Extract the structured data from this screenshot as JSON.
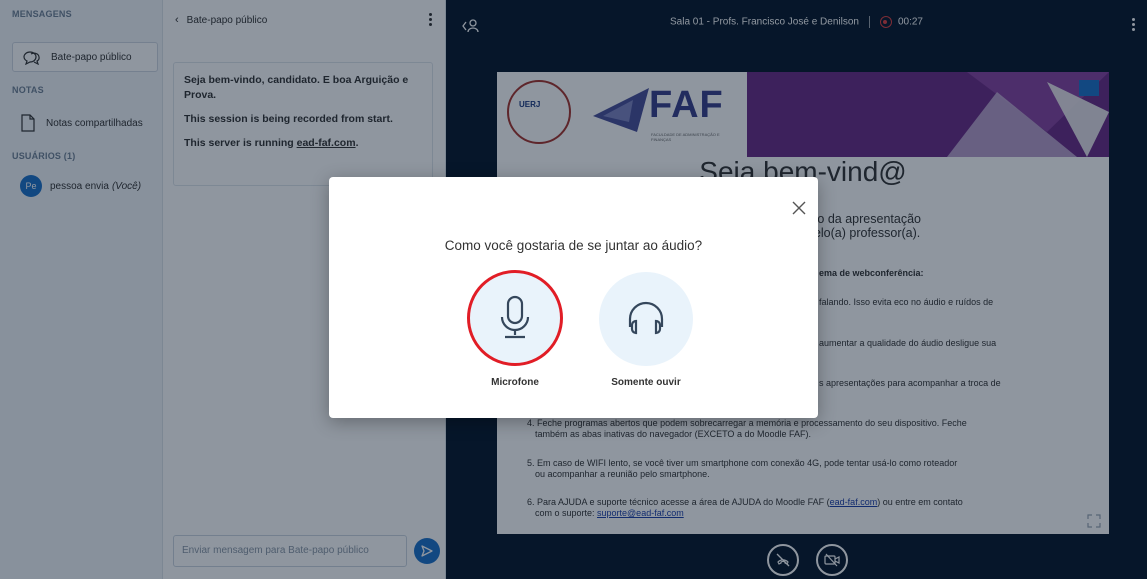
{
  "sidebar": {
    "messages_title": "MENSAGENS",
    "public_chat_label": "Bate-papo público",
    "notes_title": "NOTAS",
    "shared_notes_label": "Notas compartilhadas",
    "users_title": "USUÁRIOS (1)",
    "user": {
      "initials": "Pe",
      "name": "pessoa envia",
      "you_tag": "(Você)"
    }
  },
  "chat": {
    "header_title": "Bate-papo público",
    "welcome_line1": "Seja bem-vindo, candidato. E boa Arguição e Prova.",
    "welcome_line2": "This session is being recorded from start.",
    "welcome_line3_prefix": "This server is running ",
    "welcome_line3_link": "ead-faf.com",
    "welcome_line3_suffix": ".",
    "input_placeholder": "Enviar mensagem para Bate-papo público"
  },
  "topbar": {
    "room_title": "Sala 01 - Profs. Francisco José e Denilson",
    "recording_time": "00:27"
  },
  "slide": {
    "uerj_label": "UERJ",
    "faf_word": "FAF",
    "faf_subtitle": "FACULDADE DE ADMINISTRAÇÃO E FINANÇAS",
    "title": "Seja bem-vind@",
    "subtitle_line1": "nto da apresentação",
    "subtitle_line2": "pelo(a) professor(a).",
    "rules_heading": "ema de webconferência:",
    "line1": "falando. Isso evita eco no áudio e ruídos de",
    "line2": "aumentar a qualidade do áudio desligue sua",
    "line3": "s apresentações para acompanhar a troca de",
    "item4a": "4. Feche programas abertos que podem sobrecarregar a memória e processamento do seu dispositivo. Feche",
    "item4b": "também as abas inativas do navegador (EXCETO a do Moodle FAF).",
    "item5a": "5. Em caso de WIFI lento, se você tiver um smartphone com conexão 4G, pode tentar usá-lo como roteador",
    "item5b": "ou acompanhar a reunião pelo smartphone.",
    "item6a_prefix": "6. Para AJUDA e suporte técnico acesse a área de AJUDA do Moodle FAF (",
    "item6a_link": "ead-faf.com",
    "item6a_suffix": ") ou entre em contato",
    "item6b_prefix": "com o suporte: ",
    "item6b_link": "suporte@ead-faf.com"
  },
  "modal": {
    "question": "Como você gostaria de se juntar ao áudio?",
    "microphone_label": "Microfone",
    "listen_only_label": "Somente ouvir"
  },
  "colors": {
    "accent": "#1d71c9",
    "highlight_ring": "#e11d26",
    "recording": "#e04040",
    "background_dark": "#06172a",
    "slide_purple": "#6b2a85"
  }
}
